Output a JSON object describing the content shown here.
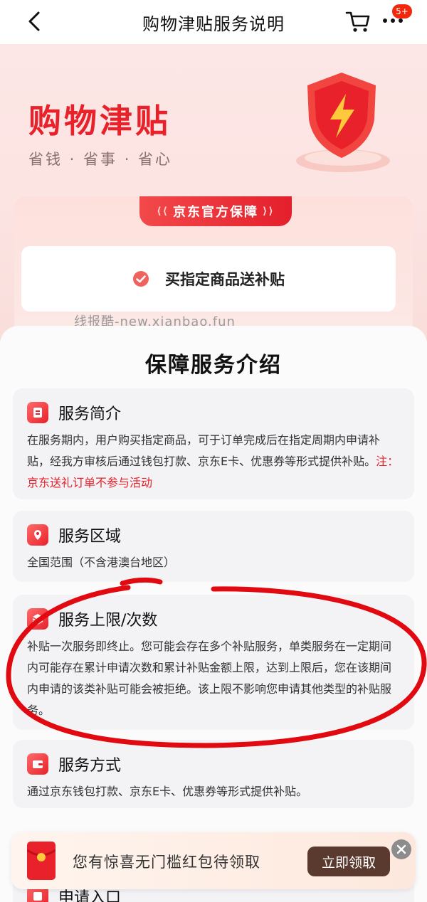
{
  "nav": {
    "title": "购物津贴服务说明",
    "badge": "5+",
    "icons": [
      "back-chevron-icon",
      "cart-icon",
      "more-dots-icon"
    ]
  },
  "hero": {
    "title": "购物津贴",
    "subtitle": "省钱 · 省事 · 省心",
    "ribbon": "京东官方保障",
    "guarantee": "买指定商品送补贴",
    "watermark": "线报酷-new.xianbao.fun",
    "colors": {
      "brand_red": "#e8212a",
      "hero_bg": "#fce7e6"
    }
  },
  "intro": {
    "title": "保障服务介绍",
    "cards": [
      {
        "icon": "receipt-icon",
        "title": "服务简介",
        "body": "在服务期内，用户购买指定商品，可于订单完成后在指定周期内申请补贴，经我方审核后通过钱包打款、京东E卡、优惠券等形式提供补贴。",
        "note": "注：京东送礼订单不参与活动"
      },
      {
        "icon": "location-icon",
        "title": "服务区域",
        "body": "全国范围（不含港澳台地区）"
      },
      {
        "icon": "layers-icon",
        "title": "服务上限/次数",
        "body": "补贴一次服务即终止。您可能会存在多个补贴服务，单类服务在一定期间内可能存在累计申请次数和累计补贴金额上限，达到上限后，您在该期间内申请的该类补贴可能会被拒绝。该上限不影响您申请其他类型的补贴服务。"
      },
      {
        "icon": "wallet-icon",
        "title": "服务方式",
        "body": "通过京东钱包打款、京东E卡、优惠券等形式提供补贴。"
      },
      {
        "icon": "entry-icon",
        "title": "申请入口"
      }
    ]
  },
  "promo": {
    "text": "您有惊喜无门槛红包待领取",
    "button": "立即领取",
    "button_color": "#5a3a2e"
  }
}
